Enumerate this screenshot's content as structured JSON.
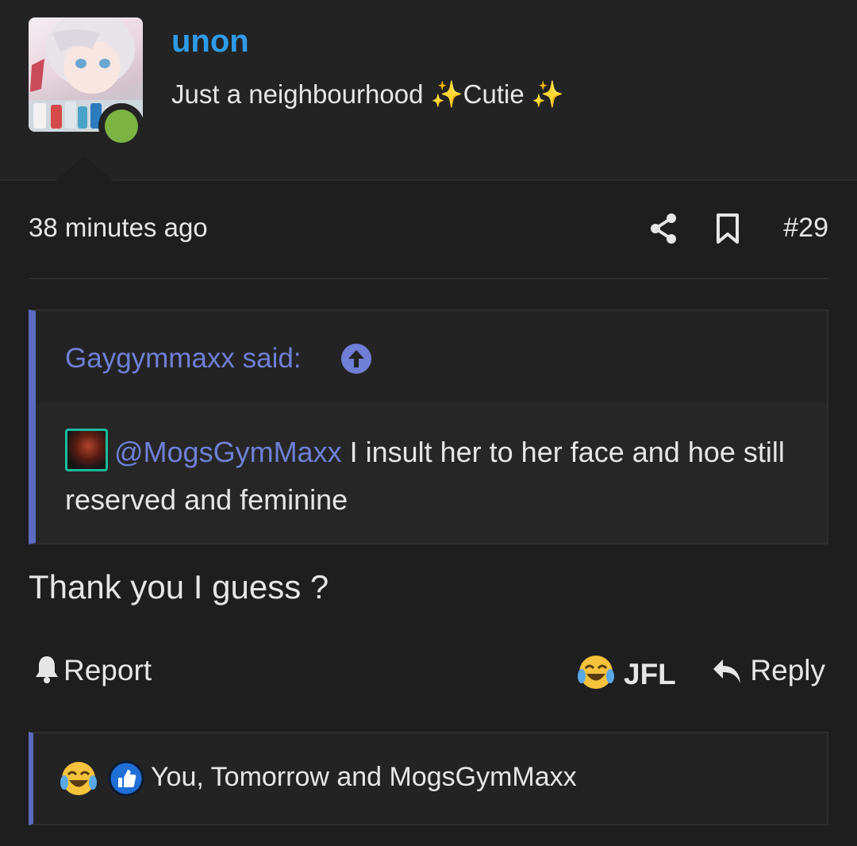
{
  "user": {
    "username": "unon",
    "title": "Just a neighbourhood ✨Cutie ✨",
    "online_status_color": "#7cb342"
  },
  "post": {
    "timestamp": "38 minutes ago",
    "number": "#29",
    "body": "Thank you I guess ?"
  },
  "quote": {
    "author": "Gaygymmaxx said:",
    "mention": "@MogsGymMaxx",
    "text": " I insult her to her face and hoe still reserved and feminine"
  },
  "actions": {
    "report": "Report",
    "jfl": "JFL",
    "reply": "Reply"
  },
  "reactions": {
    "summary": "You, Tomorrow and MogsGymMaxx",
    "icons": [
      "laughing-crying-emoji-icon",
      "thumbs-up-icon"
    ]
  },
  "colors": {
    "username": "#2f9be6",
    "quote_accent": "#5c6bc0",
    "mention": "#6f7fd6",
    "background": "#1e1e1e"
  }
}
